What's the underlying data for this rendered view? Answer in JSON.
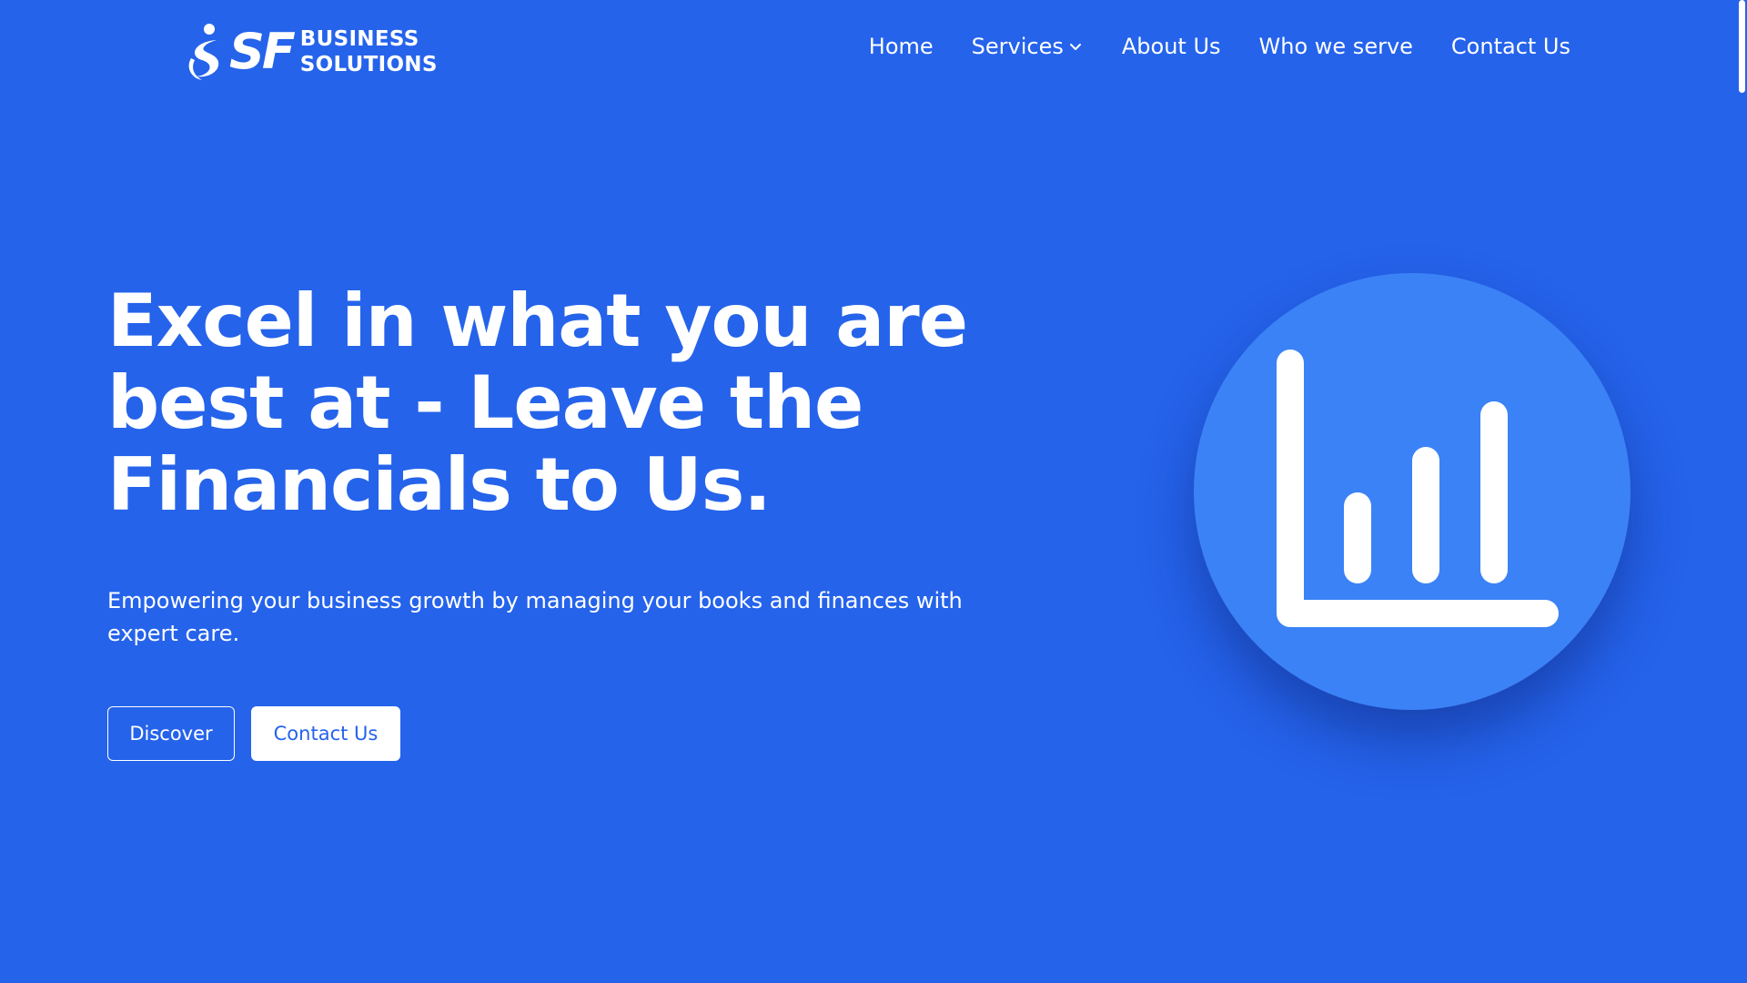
{
  "brand": {
    "logo_mark": "SF",
    "logo_line1": "BUSINESS",
    "logo_line2": "SOLUTIONS",
    "logo_icon": "person-swoosh-icon"
  },
  "nav": {
    "items": [
      {
        "label": "Home"
      },
      {
        "label": "Services",
        "icon": "chevron-down-icon"
      },
      {
        "label": "About Us"
      },
      {
        "label": "Who we serve"
      },
      {
        "label": "Contact Us"
      }
    ]
  },
  "hero": {
    "title": "Excel in what you are best at - Leave the Financials to Us.",
    "subtitle": "Empowering your business growth by managing your books and finances with expert care.",
    "discover_label": "Discover",
    "contact_label": "Contact Us"
  },
  "illustration": {
    "icon": "bar-chart-icon",
    "bar_levels": [
      0.35,
      0.6,
      0.85
    ]
  },
  "colors": {
    "background": "#2563eb",
    "circle": "#3b82f6",
    "text": "#ffffff",
    "button_text_accent": "#2563eb"
  }
}
